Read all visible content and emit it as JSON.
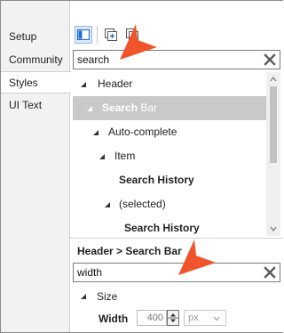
{
  "nav": {
    "items": [
      {
        "label": "Setup",
        "active": false
      },
      {
        "label": "Community",
        "active": false
      },
      {
        "label": "Styles",
        "active": true
      },
      {
        "label": "UI Text",
        "active": false
      }
    ]
  },
  "toolbar": {
    "icons": [
      "layout-panel-icon",
      "add-style-icon",
      "copy-style-icon"
    ]
  },
  "search": {
    "value": "search"
  },
  "tree": {
    "rows": [
      {
        "match": "",
        "rest": "Header",
        "bold": false,
        "expanded": true,
        "selected": false
      },
      {
        "match": "Search",
        "rest": " Bar",
        "bold": false,
        "expanded": true,
        "selected": true
      },
      {
        "match": "",
        "rest": "Auto-complete",
        "bold": false,
        "expanded": true,
        "selected": false
      },
      {
        "match": "",
        "rest": "Item",
        "bold": false,
        "expanded": true,
        "selected": false
      },
      {
        "match": "Search",
        "rest": " History",
        "bold": true,
        "expanded": null,
        "selected": false
      },
      {
        "match": "",
        "rest": "(selected)",
        "bold": false,
        "expanded": true,
        "selected": false
      },
      {
        "match": "Search",
        "rest": " History",
        "bold": true,
        "expanded": null,
        "selected": false
      }
    ]
  },
  "details": {
    "breadcrumb": "Header > Search Bar",
    "filter_value": "width",
    "group_label": "Size",
    "property_label": "Width",
    "property_value": "400",
    "unit": "px"
  },
  "colors": {
    "accent": "#1e6fd9",
    "callout": "#f0542b",
    "selection": "#c9c9c9"
  }
}
